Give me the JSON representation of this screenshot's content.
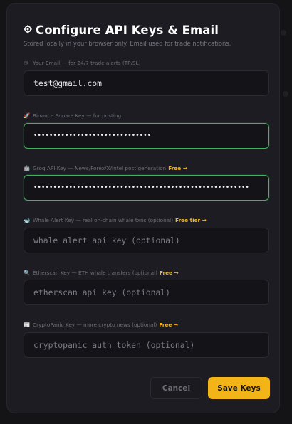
{
  "modal": {
    "title": "Configure API Keys & Email",
    "title_icon": "gear-icon",
    "subtitle": "Stored locally in your browser only. Email used for trade notifications."
  },
  "fields": [
    {
      "icon": "envelope-icon",
      "icon_glyph": "✉",
      "label": "Your Email — for 24/7 trade alerts (TP/SL)",
      "free_link": "",
      "value": "test@gmail.com",
      "placeholder": "",
      "state": "filled"
    },
    {
      "icon": "rocket-icon",
      "icon_glyph": "🚀",
      "label": "Binance Square Key — for posting",
      "free_link": "",
      "value": "••••••••••••••••••••••••••••••",
      "placeholder": "",
      "state": "focused-masked"
    },
    {
      "icon": "robot-icon",
      "icon_glyph": "🤖",
      "label": "Groq API Key — News/Forex/X/Intel post generation",
      "free_link": "Free →",
      "value": "•••••••••••••••••••••••••••••••••••••••••••••••••••••••",
      "placeholder": "",
      "state": "focused-masked"
    },
    {
      "icon": "whale-icon",
      "icon_glyph": "🐋",
      "label": "Whale Alert Key — real on-chain whale txns (optional)",
      "free_link": "Free tier →",
      "value": "",
      "placeholder": "whale alert api key (optional)",
      "state": "empty"
    },
    {
      "icon": "magnifier-icon",
      "icon_glyph": "🔍",
      "label": "Etherscan Key — ETH whale transfers (optional)",
      "free_link": "Free →",
      "value": "",
      "placeholder": "etherscan api key (optional)",
      "state": "empty"
    },
    {
      "icon": "newspaper-icon",
      "icon_glyph": "📰",
      "label": "CryptoPanic Key — more crypto news (optional)",
      "free_link": "Free →",
      "value": "",
      "placeholder": "cryptopanic auth token (optional)",
      "state": "empty"
    }
  ],
  "buttons": {
    "cancel_label": "Cancel",
    "save_label": "Save Keys"
  },
  "colors": {
    "accent": "#f2b417",
    "focus_border": "#3fb45c",
    "modal_bg": "#1c1c22",
    "input_bg": "#141418"
  }
}
